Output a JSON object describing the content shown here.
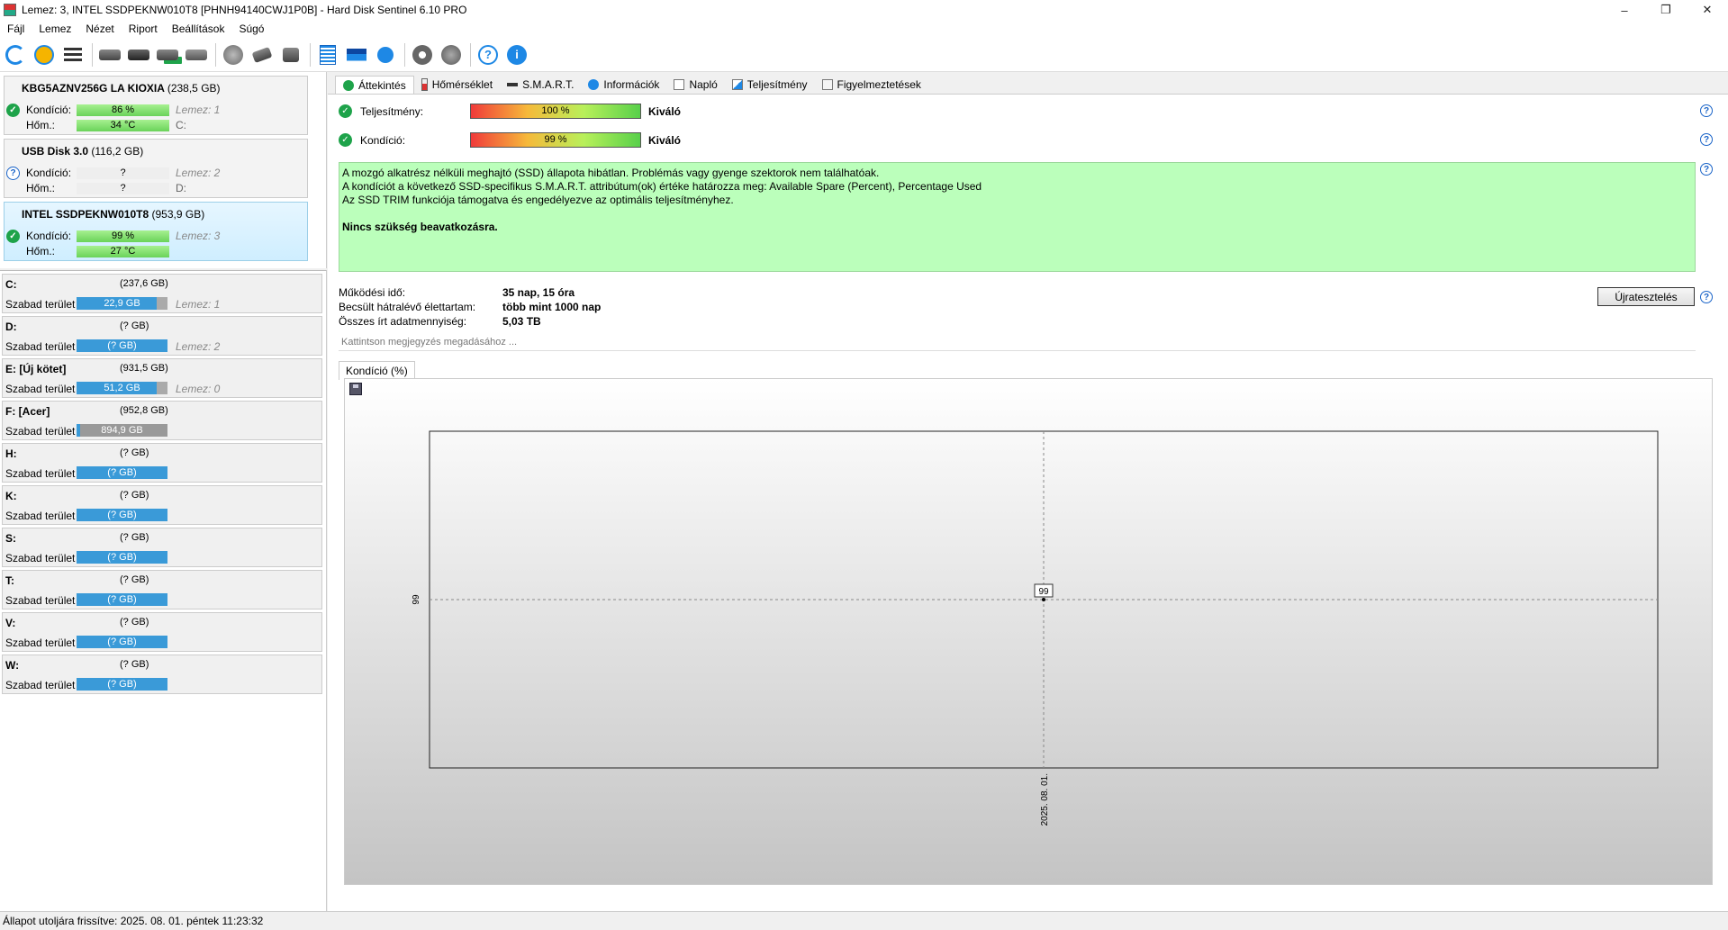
{
  "window": {
    "title": "Lemez: 3, INTEL SSDPEKNW010T8 [PHNH94140CWJ1P0B]  -  Hard Disk Sentinel 6.10 PRO",
    "minimize": "–",
    "maximize": "❐",
    "close": "✕"
  },
  "menu": [
    "Fájl",
    "Lemez",
    "Nézet",
    "Riport",
    "Beállítások",
    "Súgó"
  ],
  "disks": [
    {
      "name": "KBG5AZNV256G LA KIOXIA",
      "size": "(238,5 GB)",
      "kondicio_label": "Kondíció:",
      "kondicio": "86 %",
      "disk": "Lemez: 1",
      "hom_label": "Hőm.:",
      "hom": "34 °C",
      "drive": "C:"
    },
    {
      "name": "USB    Disk 3.0",
      "size": "(116,2 GB)",
      "kondicio_label": "Kondíció:",
      "kondicio": "?",
      "disk": "Lemez: 2",
      "hom_label": "Hőm.:",
      "hom": "?",
      "drive": "D:"
    },
    {
      "name": "INTEL SSDPEKNW010T8",
      "size": "(953,9 GB)",
      "kondicio_label": "Kondíció:",
      "kondicio": "99 %",
      "disk": "Lemez: 3",
      "hom_label": "Hőm.:",
      "hom": "27 °C",
      "drive": ""
    }
  ],
  "volumes": [
    {
      "name": "C:",
      "size": "(237,6 GB)",
      "free_label": "Szabad terület",
      "free": "22,9 GB",
      "disk": "Lemez: 1"
    },
    {
      "name": "D:",
      "size": "(? GB)",
      "free_label": "Szabad terület",
      "free": "(? GB)",
      "disk": "Lemez: 2"
    },
    {
      "name": "E: [Új kötet]",
      "size": "(931,5 GB)",
      "free_label": "Szabad terület",
      "free": "51,2 GB",
      "disk": "Lemez: 0"
    },
    {
      "name": "F: [Acer]",
      "size": "(952,8 GB)",
      "free_label": "Szabad terület",
      "free": "894,9 GB",
      "disk": ""
    },
    {
      "name": "H:",
      "size": "(? GB)",
      "free_label": "Szabad terület",
      "free": "(? GB)",
      "disk": ""
    },
    {
      "name": "K:",
      "size": "(? GB)",
      "free_label": "Szabad terület",
      "free": "(? GB)",
      "disk": ""
    },
    {
      "name": "S:",
      "size": "(? GB)",
      "free_label": "Szabad terület",
      "free": "(? GB)",
      "disk": ""
    },
    {
      "name": "T:",
      "size": "(? GB)",
      "free_label": "Szabad terület",
      "free": "(? GB)",
      "disk": ""
    },
    {
      "name": "V:",
      "size": "(? GB)",
      "free_label": "Szabad terület",
      "free": "(? GB)",
      "disk": ""
    },
    {
      "name": "W:",
      "size": "(? GB)",
      "free_label": "Szabad terület",
      "free": "(? GB)",
      "disk": ""
    }
  ],
  "tabs": [
    "Áttekintés",
    "Hőmérséklet",
    "S.M.A.R.T.",
    "Információk",
    "Napló",
    "Teljesítmény",
    "Figyelmeztetések"
  ],
  "overview": {
    "performance_label": "Teljesítmény:",
    "performance_value": "100 %",
    "performance_rating": "Kiváló",
    "condition_label": "Kondíció:",
    "condition_value": "99 %",
    "condition_rating": "Kiváló",
    "message_lines": [
      "A mozgó alkatrész nélküli meghajtó (SSD) állapota hibátlan. Problémás vagy gyenge szektorok nem találhatóak.",
      "A kondíciót a következő SSD-specifikus S.M.A.R.T. attribútum(ok) értéke határozza meg:  Available Spare (Percent), Percentage Used",
      "Az SSD TRIM funkciója támogatva és engedélyezve az optimális teljesítményhez."
    ],
    "message_action": "Nincs szükség beavatkozásra.",
    "uptime_label": "Működési idő:",
    "uptime_value": "35 nap, 15 óra",
    "lifetime_label": "Becsült hátralévő élettartam:",
    "lifetime_value": "több mint 1000 nap",
    "written_label": "Összes írt adatmennyiség:",
    "written_value": "5,03 TB",
    "retest_button": "Újratesztelés",
    "note_placeholder": "Kattintson megjegyzés megadásához ...",
    "chart_tab": "Kondíció  (%)",
    "help": "?"
  },
  "chart_data": {
    "type": "line",
    "x": [
      "2025. 08. 01."
    ],
    "series": [
      {
        "values": [
          99
        ]
      }
    ],
    "data_labels": [
      "99"
    ],
    "ytick_labels": [
      "99"
    ],
    "xtick_labels": [
      "2025. 08. 01."
    ],
    "grid": "crosshair"
  },
  "statusbar": "Állapot utoljára frissítve: 2025. 08. 01. péntek 11:23:32"
}
